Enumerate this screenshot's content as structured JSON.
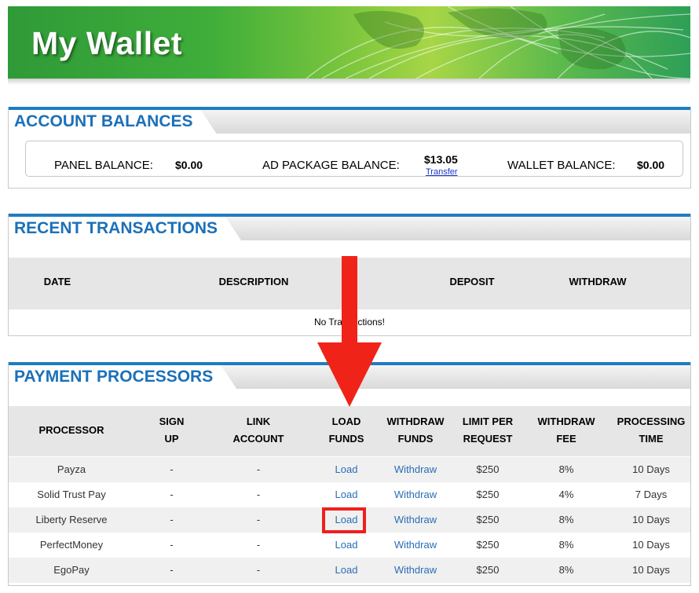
{
  "banner": {
    "title": "My Wallet"
  },
  "account_balances": {
    "title": "ACCOUNT BALANCES",
    "panel_label": "PANEL BALANCE:",
    "panel_value": "$0.00",
    "ad_package_label": "AD PACKAGE BALANCE:",
    "ad_package_value": "$13.05",
    "transfer_link": "Transfer",
    "wallet_label": "WALLET BALANCE:",
    "wallet_value": "$0.00"
  },
  "recent_transactions": {
    "title": "RECENT TRANSACTIONS",
    "columns": [
      "DATE",
      "DESCRIPTION",
      "DEPOSIT",
      "WITHDRAW"
    ],
    "empty_message": "No Transactions!"
  },
  "payment_processors": {
    "title": "PAYMENT PROCESSORS",
    "columns": [
      [
        "PROCESSOR"
      ],
      [
        "SIGN",
        "UP"
      ],
      [
        "LINK",
        "ACCOUNT"
      ],
      [
        "LOAD",
        "FUNDS"
      ],
      [
        "WITHDRAW",
        "FUNDS"
      ],
      [
        "LIMIT PER",
        "REQUEST"
      ],
      [
        "WITHDRAW",
        "FEE"
      ],
      [
        "PROCESSING",
        "TIME"
      ]
    ],
    "rows": [
      {
        "processor": "Payza",
        "signup": "-",
        "link": "-",
        "load": "Load",
        "withdraw": "Withdraw",
        "limit": "$250",
        "fee": "8%",
        "time": "10 Days"
      },
      {
        "processor": "Solid Trust Pay",
        "signup": "-",
        "link": "-",
        "load": "Load",
        "withdraw": "Withdraw",
        "limit": "$250",
        "fee": "4%",
        "time": "7 Days"
      },
      {
        "processor": "Liberty Reserve",
        "signup": "-",
        "link": "-",
        "load": "Load",
        "withdraw": "Withdraw",
        "limit": "$250",
        "fee": "8%",
        "time": "10 Days"
      },
      {
        "processor": "PerfectMoney",
        "signup": "-",
        "link": "-",
        "load": "Load",
        "withdraw": "Withdraw",
        "limit": "$250",
        "fee": "8%",
        "time": "10 Days"
      },
      {
        "processor": "EgoPay",
        "signup": "-",
        "link": "-",
        "load": "Load",
        "withdraw": "Withdraw",
        "limit": "$250",
        "fee": "8%",
        "time": "10 Days"
      }
    ]
  },
  "colors": {
    "accent_blue": "#1b70b8",
    "link_blue": "#2a6db5",
    "annotation_red": "#f02318",
    "banner_green": "#3fae3a"
  },
  "annotation": {
    "arrow_icon": "down-arrow-icon",
    "highlight": "highlight-box"
  }
}
